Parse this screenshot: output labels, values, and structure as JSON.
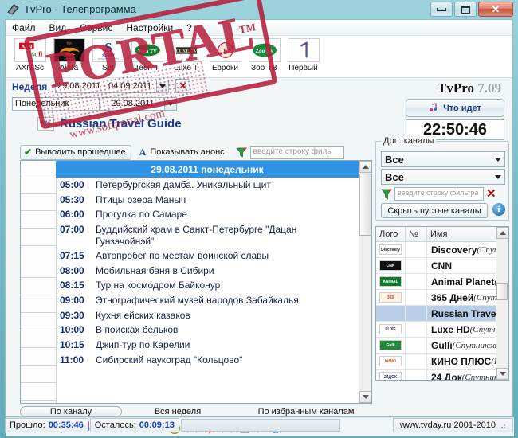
{
  "window": {
    "title": "TvPro - Телепрограмма",
    "icon": "app-icon",
    "buttons": {
      "minimize": "minimize-icon",
      "maximize": "maximize-icon",
      "close": "✕"
    }
  },
  "menu": {
    "items": [
      "Файл",
      "Вид",
      "Сервис",
      "Настройки",
      "?"
    ]
  },
  "channel_toolbar": [
    {
      "name": "AXN Sc",
      "logo_text": "AXN sci fi",
      "logo_colors": {
        "bg": "#ffffff",
        "fg": "#cc1122"
      }
    },
    {
      "name": "Ajara",
      "logo_text": "Ajara",
      "logo_colors": {
        "bg": "#111111",
        "fg": "#e08a1e"
      }
    },
    {
      "name": "Set",
      "logo_text": "SONY",
      "logo_colors": {
        "bg": "#ffffff",
        "fg": "#1b3f9e"
      }
    },
    {
      "name": "Teen T",
      "logo_text": "Teen TV",
      "logo_colors": {
        "bg": "#ffffff",
        "fg": "#1a7a2e"
      }
    },
    {
      "name": "Luxe T",
      "logo_text": "LUXE",
      "logo_colors": {
        "bg": "#ffffff",
        "fg": "#333333"
      }
    },
    {
      "name": "Евроки",
      "logo_text": "EURO",
      "logo_colors": {
        "bg": "#ffffff",
        "fg": "#c8102e"
      }
    },
    {
      "name": "Зоо ТВ",
      "logo_text": "Zoo TV",
      "logo_colors": {
        "bg": "#ffffff",
        "fg": "#1a8a3c"
      }
    },
    {
      "name": "Первый",
      "logo_text": "1",
      "logo_colors": {
        "bg": "#ffffff",
        "fg": "#2a58a8"
      }
    }
  ],
  "date_bar": {
    "week_label": "Неделя",
    "week_range": "29.08.2011 - 04.09.2011",
    "clear_icon": "✕",
    "day_name": "Понедельник",
    "day_date": "29.08.2011"
  },
  "brand": {
    "name": "TvPro",
    "version": "7.09"
  },
  "whats_on": {
    "label": "Что идет",
    "icon": "note-icon"
  },
  "clock": "22:50:46",
  "current_channel": {
    "name": "Russian Travel Guide",
    "logo": "rtg-logo"
  },
  "options": {
    "show_past_label": "Выводить прошедшее",
    "show_past_checked": true,
    "show_announce_label": "Показывать анонс",
    "announce_icon": "A",
    "filter_icon": "funnel-icon",
    "filter_placeholder": "введите строку филь"
  },
  "program_grid": {
    "day_header": "29.08.2011 понедельник",
    "rows": [
      {
        "time": "05:00",
        "title": "Петербургская дамба. Уникальный щит"
      },
      {
        "time": "05:30",
        "title": "Птицы озера Маныч"
      },
      {
        "time": "06:00",
        "title": "Прогулка по Самаре"
      },
      {
        "time": "07:00",
        "title": "Буддийский храм в Санкт-Петербурге \"Дацан Гунзэчойнэй\""
      },
      {
        "time": "07:15",
        "title": "Автопробег по местам воинской славы"
      },
      {
        "time": "08:00",
        "title": "Мобильная баня в Сибири"
      },
      {
        "time": "08:15",
        "title": "Тур на космодром Байконур"
      },
      {
        "time": "09:00",
        "title": "Этнографический музей народов Забайкалья"
      },
      {
        "time": "09:30",
        "title": "Кухня ейских казаков"
      },
      {
        "time": "10:00",
        "title": "В поисках бельков"
      },
      {
        "time": "10:15",
        "title": "Джип-тур по Карелии"
      },
      {
        "time": "11:00",
        "title": "Сибирский наукоград \"Кольцово\""
      }
    ]
  },
  "right_panel": {
    "group_title": "Доп. каналы",
    "combo1": "Все",
    "combo2": "Все",
    "filter_placeholder": "введите строку фильтра",
    "clear_icon": "✕",
    "hide_empty_label": "Скрыть пустые каналы",
    "info_icon": "i",
    "table": {
      "headers": [
        "Лого",
        "№",
        "Имя"
      ],
      "rows": [
        {
          "logo": "discovery-logo",
          "num": "",
          "name": "Discovery",
          "sat": "(Спутн",
          "selected": false
        },
        {
          "logo": "cnn-logo",
          "num": "",
          "name": "CNN",
          "sat": "",
          "selected": false
        },
        {
          "logo": "animal-planet-logo",
          "num": "",
          "name": "Animal Planet",
          "sat": "(С",
          "selected": false
        },
        {
          "logo": "365dney-logo",
          "num": "",
          "name": "365 Дней",
          "sat": "(Спутн",
          "selected": false
        },
        {
          "logo": "rtg-logo",
          "num": "",
          "name": "Russian Travel",
          "sat": "",
          "selected": true
        },
        {
          "logo": "luxehd-logo",
          "num": "",
          "name": "Luxe HD",
          "sat": "(Спутник",
          "selected": false
        },
        {
          "logo": "gulli-logo",
          "num": "",
          "name": "Gulli",
          "sat": "(Спутниковы",
          "selected": false
        },
        {
          "logo": "kinoplus-logo",
          "num": "",
          "name": "КИНО ПЛЮС",
          "sat": "(Н",
          "selected": false
        },
        {
          "logo": "24dok-logo",
          "num": "",
          "name": "24 Док",
          "sat": "(Спутник",
          "selected": false
        }
      ]
    }
  },
  "tabs": [
    {
      "label": "По каналу",
      "active": true
    },
    {
      "label": "Вся неделя",
      "active": false
    },
    {
      "label": "По избранным каналам",
      "active": false
    }
  ],
  "bottom_toolbar": [
    {
      "icon": "prev-arrow-icon"
    },
    {
      "icon": "next-arrow-icon"
    },
    {
      "icon": "whats-on-icon"
    },
    {
      "icon": "search-icon"
    },
    {
      "icon": "palette-icon"
    },
    {
      "icon": "alert-icon"
    },
    {
      "icon": "print-icon"
    },
    {
      "icon": "globe-icon"
    }
  ],
  "status_bar": {
    "elapsed_label": "Прошло:",
    "elapsed_value": "00:35:46",
    "remaining_label": "Осталось:",
    "remaining_value": "00:09:13",
    "url": "www.tvday.ru 2001-2010"
  },
  "watermark": {
    "text": "PORTAL",
    "tm": "TM",
    "url": "www.softportal.com"
  }
}
